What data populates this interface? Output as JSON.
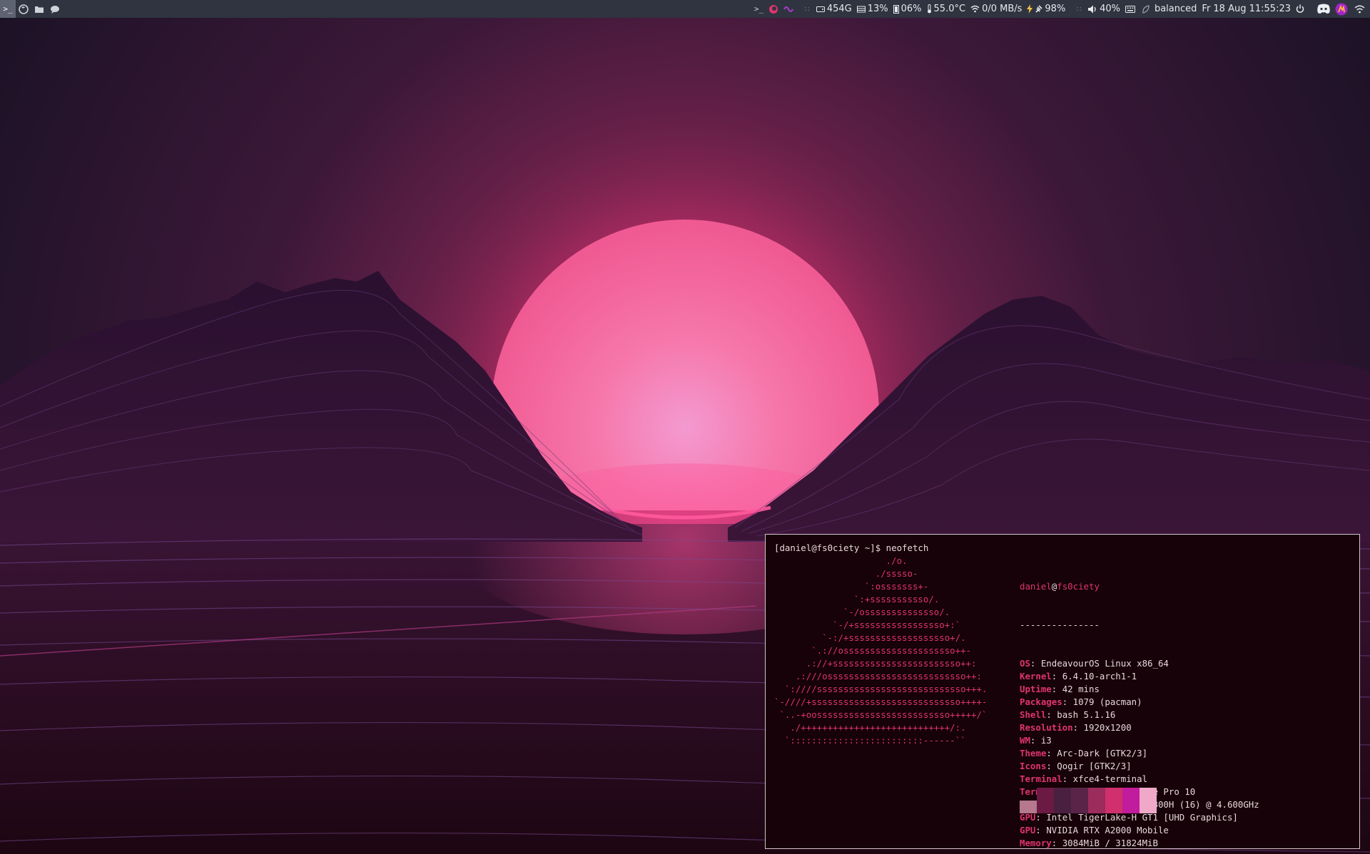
{
  "topbar": {
    "workspaces": [
      {
        "icon": "terminal-icon",
        "glyph": ">_",
        "active": true
      },
      {
        "icon": "firefox-icon",
        "active": false
      },
      {
        "icon": "folder-icon",
        "active": false
      },
      {
        "icon": "chat-icon",
        "active": false
      }
    ],
    "status": {
      "prompt_glyph": ">_",
      "separator": "::",
      "disk": "454G",
      "memory": "13%",
      "swap": "06%",
      "temperature": "55.0°C",
      "network": "0/0 MB/s",
      "battery": "98%",
      "volume": "40%",
      "power_profile": "balanced",
      "datetime": "Fr 18 Aug 11:55:23"
    },
    "tray": [
      "discord-icon",
      "app-icon",
      "wifi-icon"
    ]
  },
  "terminal": {
    "prompt": "[daniel@fs0ciety ~]$ neofetch",
    "logo_lines": [
      "                     ./o.",
      "                   ./sssso-",
      "                 `:osssssss+-",
      "               `:+sssssssssso/.",
      "             `-/ossssssssssssso/.",
      "           `-/+sssssssssssssssso+:`",
      "         `-:/+sssssssssssssssssso+/.",
      "       `.://osssssssssssssssssssso++-",
      "      .://+ssssssssssssssssssssssso++:",
      "    .:///ossssssssssssssssssssssssso++:",
      "  `:////ssssssssssssssssssssssssssso+++.",
      "`-////+ssssssssssssssssssssssssssso++++-",
      " `..-+oosssssssssssssssssssssssso+++++/`",
      "   ./++++++++++++++++++++++++++++/:.",
      "  `:::::::::::::::::::::::::------``"
    ],
    "user": "daniel",
    "at": "@",
    "host": "fs0ciety",
    "dashes": "---------------",
    "info": [
      {
        "key": "OS",
        "value": "EndeavourOS Linux x86_64"
      },
      {
        "key": "Kernel",
        "value": "6.4.10-arch1-1"
      },
      {
        "key": "Uptime",
        "value": "42 mins"
      },
      {
        "key": "Packages",
        "value": "1079 (pacman)"
      },
      {
        "key": "Shell",
        "value": "bash 5.1.16"
      },
      {
        "key": "Resolution",
        "value": "1920x1200"
      },
      {
        "key": "WM",
        "value": "i3"
      },
      {
        "key": "Theme",
        "value": "Arc-Dark [GTK2/3]"
      },
      {
        "key": "Icons",
        "value": "Qogir [GTK2/3]"
      },
      {
        "key": "Terminal",
        "value": "xfce4-terminal"
      },
      {
        "key": "Terminal Font",
        "value": "Source Code Pro 10"
      },
      {
        "key": "CPU",
        "value": "11th Gen Intel i7-11800H (16) @ 4.600GHz"
      },
      {
        "key": "GPU",
        "value": "Intel TigerLake-H GT1 [UHD Graphics]"
      },
      {
        "key": "GPU",
        "value": "NVIDIA RTX A2000 Mobile"
      },
      {
        "key": "Memory",
        "value": "3084MiB / 31824MiB"
      }
    ],
    "swatches": [
      "#b5788e",
      "#6b1a44",
      "#4a2040",
      "#5a2448",
      "#9c2c5c",
      "#d0306c",
      "#c01c9c",
      "#f0a8c8"
    ]
  },
  "colors": {
    "accent": "#e0346e",
    "sun": "#f66aa0",
    "bar": "#2f3440",
    "terminal_bg": "#160208"
  }
}
